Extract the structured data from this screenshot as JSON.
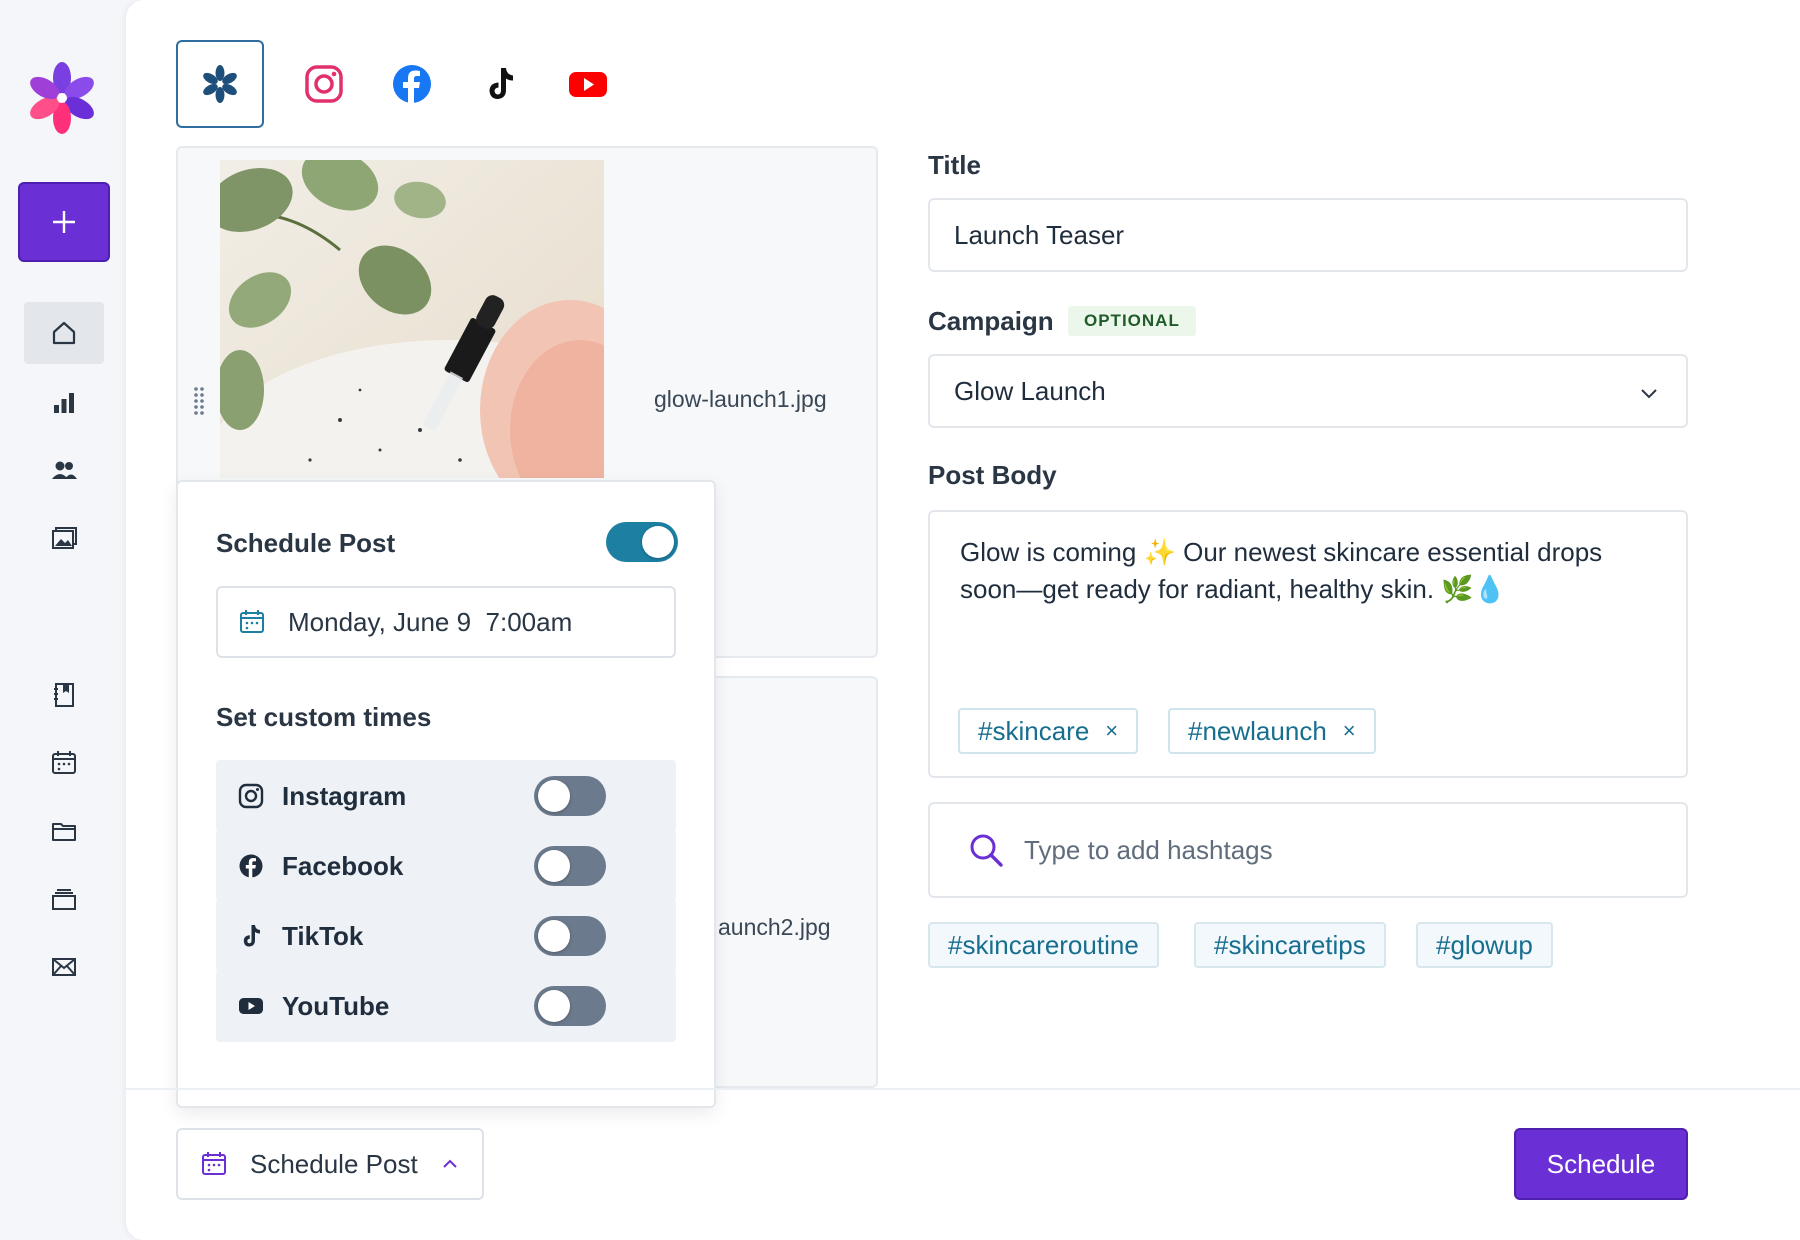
{
  "colors": {
    "brand": "#6b2fd6",
    "accent": "#1d7fa2",
    "tag_text": "#176e8f",
    "instagram": "#e1306c",
    "facebook": "#1877f2",
    "youtube": "#ff0000"
  },
  "sidebar": {
    "new_button_icon": "plus-icon",
    "items": [
      {
        "icon": "home-icon"
      },
      {
        "icon": "chart-icon"
      },
      {
        "icon": "people-icon"
      },
      {
        "icon": "image-icon"
      },
      {
        "icon": "book-icon"
      },
      {
        "icon": "calendar-icon"
      },
      {
        "icon": "folder-icon"
      },
      {
        "icon": "stack-icon"
      },
      {
        "icon": "mail-icon"
      }
    ]
  },
  "network_tabs": [
    "all-networks",
    "instagram",
    "facebook",
    "tiktok",
    "youtube"
  ],
  "media": [
    {
      "filename": "glow-launch1.jpg"
    },
    {
      "filename": "aunch2.jpg"
    }
  ],
  "schedule": {
    "title": "Schedule Post",
    "enabled": true,
    "date": "Monday, June 9  7:00am",
    "custom_title": "Set custom times",
    "networks": [
      {
        "label": "Instagram",
        "icon": "instagram-icon",
        "enabled": false
      },
      {
        "label": "Facebook",
        "icon": "facebook-icon",
        "enabled": false
      },
      {
        "label": "TikTok",
        "icon": "tiktok-icon",
        "enabled": false
      },
      {
        "label": "YouTube",
        "icon": "youtube-icon",
        "enabled": false
      }
    ]
  },
  "form": {
    "title_label": "Title",
    "title_value": "Launch Teaser",
    "campaign_label": "Campaign",
    "optional_badge": "OPTIONAL",
    "campaign_value": "Glow Launch",
    "body_label": "Post Body",
    "body_text": "Glow is coming ✨ Our newest skincare essential drops soon—get ready for radiant, healthy skin. 🌿💧",
    "tags": [
      "#skincare",
      "#newlaunch"
    ],
    "tag_remove_symbol": "×",
    "hashtag_placeholder": "Type to add hashtags",
    "suggestions": [
      "#skincareroutine",
      "#skincaretips",
      "#glowup"
    ]
  },
  "footer": {
    "schedule_dropdown": "Schedule Post",
    "schedule_button": "Schedule"
  }
}
